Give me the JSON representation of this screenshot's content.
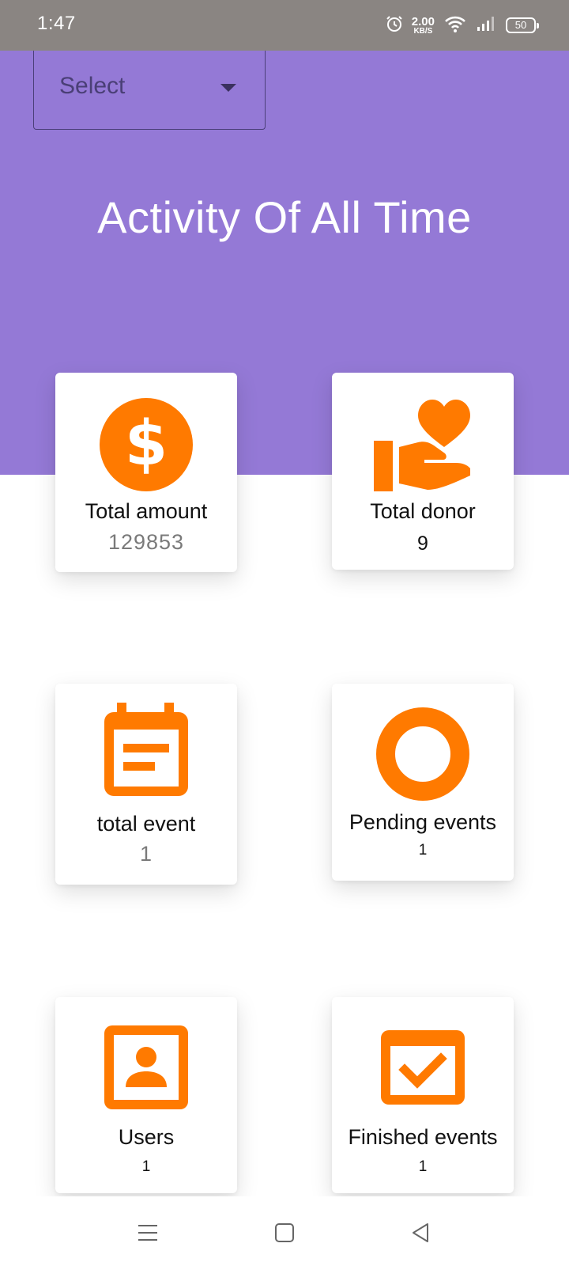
{
  "status_bar": {
    "time": "1:47",
    "net_speed_value": "2.00",
    "net_speed_unit": "KB/S",
    "battery": "50",
    "icons": [
      "alarm-icon",
      "wifi-icon",
      "signal-icon",
      "battery-icon"
    ]
  },
  "header": {
    "select_label": "Select",
    "title": "Activity Of All Time"
  },
  "cards": {
    "total_amount": {
      "label": "Total amount",
      "value": "129853",
      "icon": "dollar-circle-icon"
    },
    "total_donor": {
      "label": "Total donor",
      "value": "9",
      "icon": "hand-heart-icon"
    },
    "total_event": {
      "label": "total event",
      "value": "1",
      "icon": "calendar-icon"
    },
    "pending_events": {
      "label": "Pending events",
      "value": "1",
      "icon": "ring-icon"
    },
    "users": {
      "label": "Users",
      "value": "1",
      "icon": "contact-icon"
    },
    "finished_events": {
      "label": "Finished events",
      "value": "1",
      "icon": "calendar-check-icon"
    }
  },
  "nav": {
    "icons": [
      "menu-icon",
      "home-square-icon",
      "back-icon"
    ]
  },
  "colors": {
    "status_bar": "#8a8582",
    "header_purple": "#9479d6",
    "accent_orange": "#ff7a00",
    "select_border": "#4b3f79"
  }
}
